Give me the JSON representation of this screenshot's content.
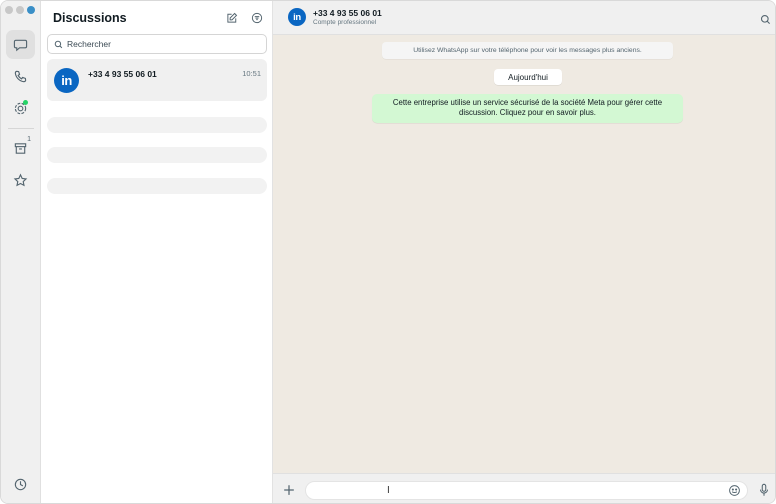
{
  "window": {
    "accent": "#25d366",
    "brand": "#0a66c2"
  },
  "rail": {
    "items": [
      {
        "name": "chats",
        "icon": "chat-bubble-icon",
        "active": true
      },
      {
        "name": "calls",
        "icon": "phone-icon"
      },
      {
        "name": "status",
        "icon": "status-ring-icon",
        "has_dot": true
      },
      {
        "name": "archive",
        "icon": "archive-icon",
        "badge": "1"
      },
      {
        "name": "starred",
        "icon": "star-icon"
      },
      {
        "name": "settings",
        "icon": "settings-icon"
      }
    ]
  },
  "list": {
    "title": "Discussions",
    "new_chat_icon": "compose-icon",
    "filter_icon": "filter-icon",
    "search": {
      "placeholder": "Rechercher",
      "value": ""
    },
    "chats": [
      {
        "name": "+33 4 93 55 06 01",
        "time": "10:51",
        "avatar": "linkedin-logo",
        "avatar_text": "in"
      }
    ]
  },
  "conversation": {
    "header": {
      "name": "+33 4 93 55 06 01",
      "subtitle": "Compte professionnel",
      "avatar_text": "in"
    },
    "system_message": "Utilisez WhatsApp sur votre téléphone pour voir les messages plus anciens.",
    "date_chip": "Aujourd'hui",
    "encryption_message": "Cette entreprise utilise un service sécurisé de la société Meta pour gérer cette discussion. Cliquez pour en savoir plus.",
    "composer": {
      "placeholder": "",
      "value": ""
    }
  }
}
